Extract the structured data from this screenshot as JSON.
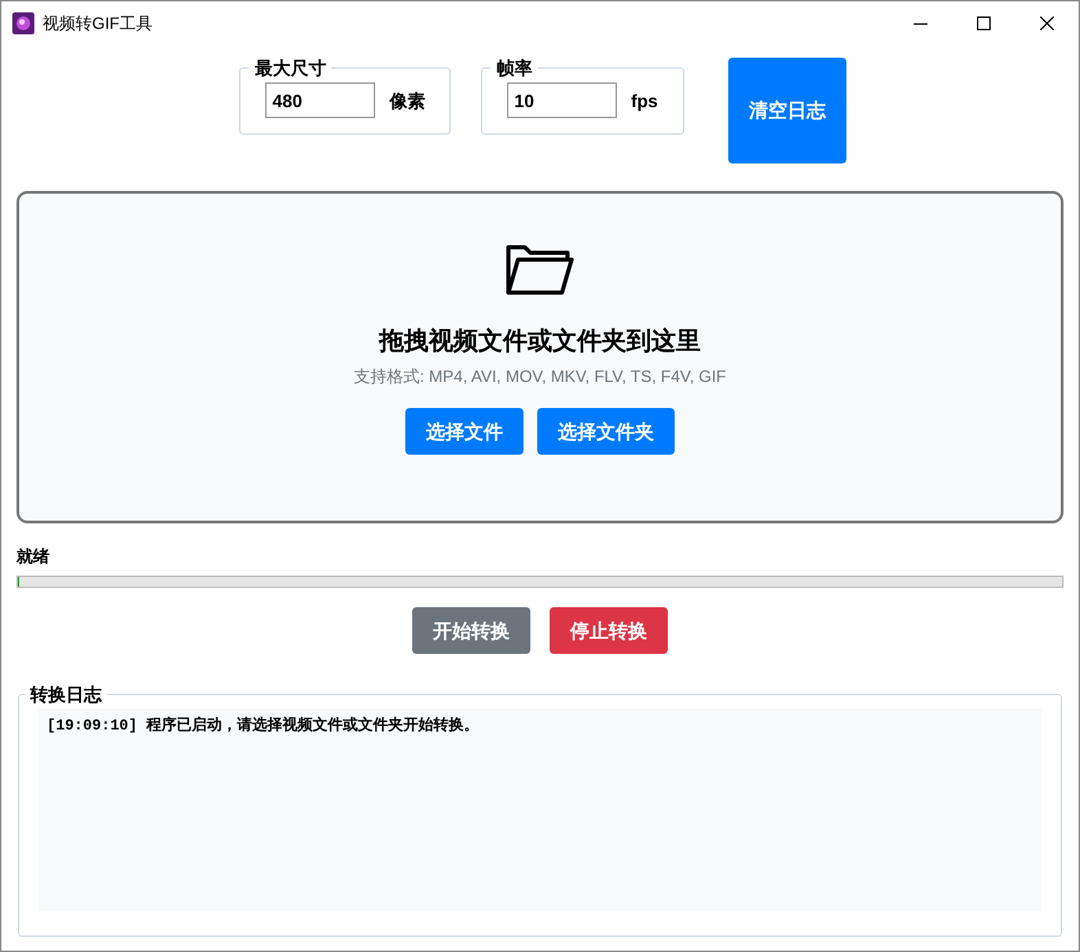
{
  "window": {
    "title": "视频转GIF工具"
  },
  "settings": [
    {
      "legend": "最大尺寸",
      "value": "480",
      "unit": "像素"
    },
    {
      "legend": "帧率",
      "value": "10",
      "unit": "fps"
    }
  ],
  "clear_button": "清空日志",
  "drop_zone": {
    "title": "拖拽视频文件或文件夹到这里",
    "formats": "支持格式: MP4, AVI, MOV, MKV, FLV, TS, F4V, GIF",
    "buttons": [
      "选择文件",
      "选择文件夹"
    ]
  },
  "status": {
    "text": "就绪",
    "level": 0
  },
  "actions": [
    {
      "label": "开始转换",
      "kind": "secondary"
    },
    {
      "label": "停止转换",
      "kind": "danger"
    }
  ],
  "log": {
    "legend": "转换日志",
    "lines": [
      "[19:09:10] 程序已启动，请选择视频文件或文件夹开始转换。"
    ]
  }
}
